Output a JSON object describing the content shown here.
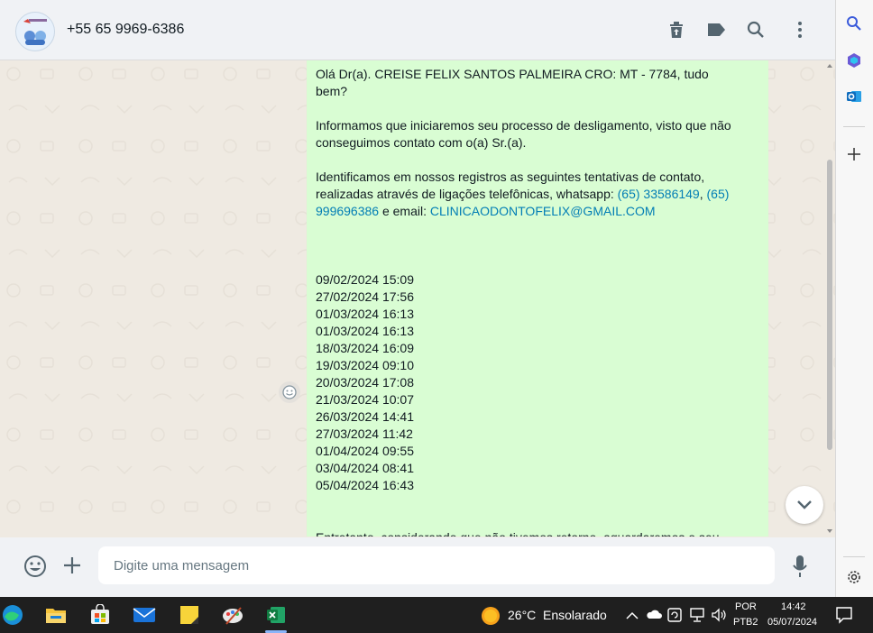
{
  "header": {
    "contact_name": "+55 65 9969-6386",
    "icons": [
      "delete-icon",
      "label-icon",
      "search-icon",
      "menu-icon"
    ]
  },
  "message": {
    "greeting": "Olá Dr(a). CREISE FELIX SANTOS PALMEIRA CRO: MT - 7784, tudo bem?",
    "para1": "Informamos que iniciaremos seu processo de desligamento, visto que não conseguimos contato com o(a) Sr.(a).",
    "para2_prefix": "Identificamos em nossos registros as seguintes tentativas de contato, realizadas através de ligações telefônicas, whatsapp: ",
    "phone1": "(65) 33586149",
    "sep": ", ",
    "phone2": "(65) 999696386",
    "email_prefix": " e email: ",
    "email": "CLINICAODONTOFELIX@GMAIL.COM",
    "dates": [
      "09/02/2024 15:09",
      "27/02/2024 17:56",
      "01/03/2024 16:13",
      "01/03/2024 16:13",
      "18/03/2024 16:09",
      "19/03/2024 09:10",
      "20/03/2024 17:08",
      "21/03/2024 10:07",
      "26/03/2024 14:41",
      "27/03/2024 11:42",
      "01/04/2024 09:55",
      "03/04/2024 08:41",
      "05/04/2024 16:43"
    ],
    "trailing_partial": "Entretanto, considerando que não tivemos retorno, aguardaremos o seu"
  },
  "composer": {
    "placeholder": "Digite uma mensagem"
  },
  "taskbar": {
    "temperature": "26°C",
    "weather": "Ensolarado",
    "lang_top": "POR",
    "lang_bottom": "PTB2",
    "time": "14:42",
    "date": "05/07/2024"
  },
  "colors": {
    "bubble": "#d9fdd3",
    "link": "#027eb5",
    "chat_bg": "#efeae2",
    "header_bg": "#f0f2f5"
  }
}
